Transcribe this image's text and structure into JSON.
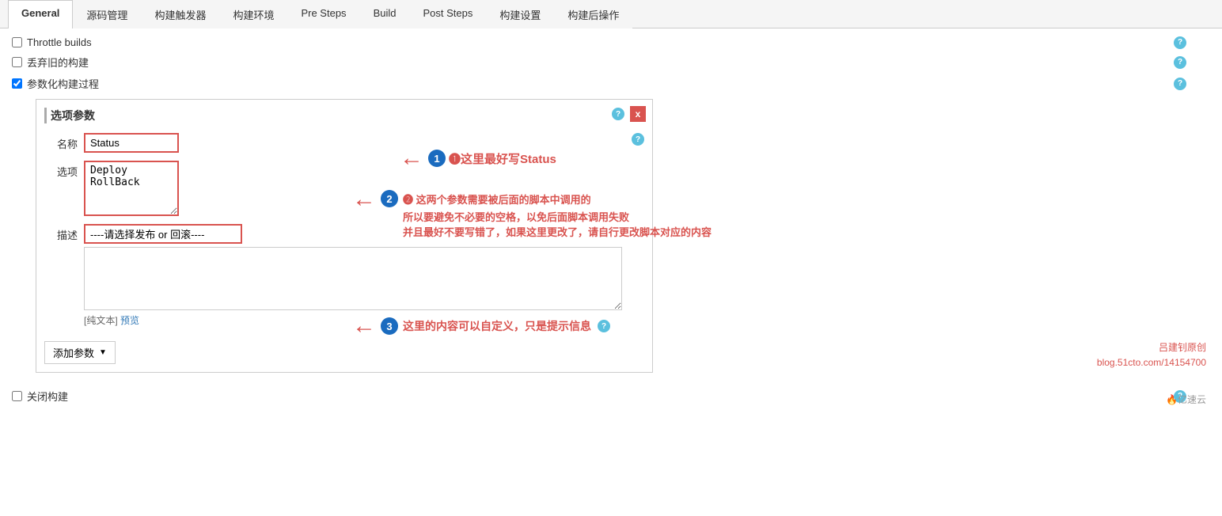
{
  "tabs": [
    {
      "label": "General",
      "active": true
    },
    {
      "label": "源码管理"
    },
    {
      "label": "构建触发器"
    },
    {
      "label": "构建环境"
    },
    {
      "label": "Pre Steps"
    },
    {
      "label": "Build"
    },
    {
      "label": "Post Steps"
    },
    {
      "label": "构建设置"
    },
    {
      "label": "构建后操作"
    }
  ],
  "checkboxes": [
    {
      "label": "Throttle builds",
      "checked": false
    },
    {
      "label": "丢弃旧的构建",
      "checked": false
    },
    {
      "label": "参数化构建过程",
      "checked": true
    }
  ],
  "panel": {
    "title": "选项参数",
    "close_label": "x",
    "name_label": "名称",
    "name_value": "Status",
    "options_label": "选项",
    "options_value": "Deploy\nRollBack",
    "desc_label": "描述",
    "desc_placeholder": "----请选择发布 or 回滚----",
    "desc_textarea_value": "",
    "plaintext_label": "[纯文本]",
    "preview_label": "预览"
  },
  "annotations": {
    "anno1_text": "❶这里最好写Status",
    "anno2_text_line1": "❷  这两个参数需要被后面的脚本中调用的",
    "anno2_text_line2": "所以要避免不必要的空格，以免后面脚本调用失败",
    "anno2_text_line3": "并且最好不要写错了，如果这里更改了，请自行更改脚本对应的内容",
    "anno3_text": "❸  这里的内容可以自定义，只是提示信息"
  },
  "add_param_label": "添加参数",
  "close_build_label": "关闭构建",
  "watermark_line1": "吕建钊原创",
  "watermark_line2": "blog.51cto.com/14154700"
}
